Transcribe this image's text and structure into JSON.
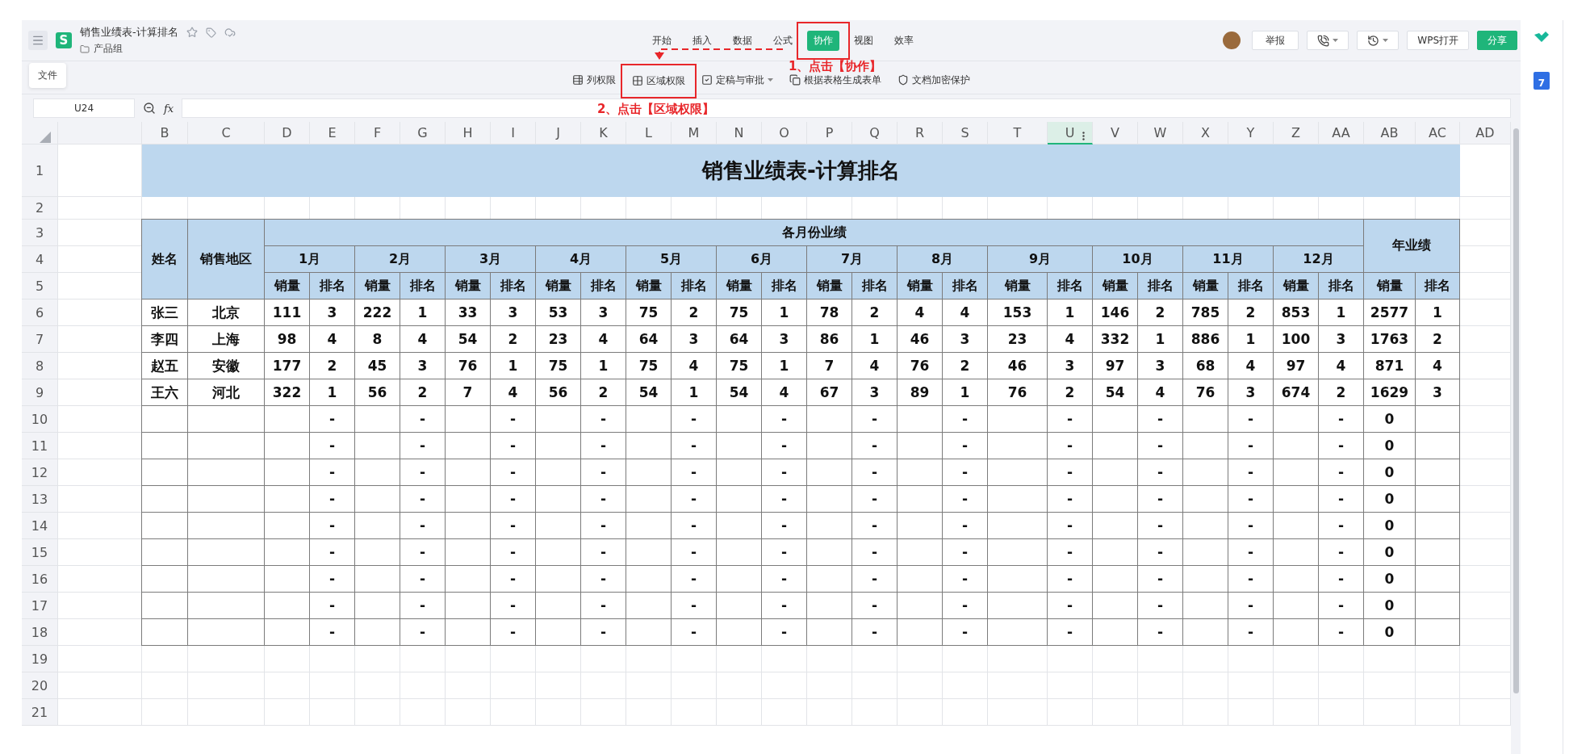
{
  "header": {
    "logo": "S",
    "title": "销售业绩表-计算排名",
    "folder": "产品组"
  },
  "tooltip": "文件",
  "menu_tabs": [
    {
      "label": "开始",
      "selected": false,
      "highlighted": false
    },
    {
      "label": "插入",
      "selected": false,
      "highlighted": false
    },
    {
      "label": "数据",
      "selected": false,
      "highlighted": false
    },
    {
      "label": "公式",
      "selected": false,
      "highlighted": false
    },
    {
      "label": "协作",
      "selected": true,
      "highlighted": true
    },
    {
      "label": "视图",
      "selected": false,
      "highlighted": false
    },
    {
      "label": "效率",
      "selected": false,
      "highlighted": false
    }
  ],
  "ribbon": [
    {
      "label": "列权限",
      "kind": "column-lock",
      "highlighted": false,
      "dropdown": false
    },
    {
      "label": "区域权限",
      "kind": "range-lock",
      "highlighted": true,
      "dropdown": false
    },
    {
      "label": "定稿与审批",
      "kind": "approval",
      "highlighted": false,
      "dropdown": true
    },
    {
      "label": "根据表格生成表单",
      "kind": "form",
      "highlighted": false,
      "dropdown": false
    },
    {
      "label": "文档加密保护",
      "kind": "shield",
      "highlighted": false,
      "dropdown": false
    }
  ],
  "header_buttons": [
    {
      "label": "举报",
      "kind": "text"
    },
    {
      "kind": "phone"
    },
    {
      "kind": "history"
    },
    {
      "label": "WPS打开",
      "kind": "text"
    },
    {
      "label": "分享",
      "kind": "primary"
    }
  ],
  "annotations": [
    {
      "text": "1、点击【协作】"
    },
    {
      "text": "2、点击【区域权限】"
    }
  ],
  "formula_bar": {
    "name_box": "U24",
    "fx_label": "fx"
  },
  "sidebar": {
    "calendar_day": "7"
  },
  "columns": [
    {
      "label": "B",
      "selected": false
    },
    {
      "label": "C",
      "selected": false
    },
    {
      "label": "D",
      "selected": false
    },
    {
      "label": "E",
      "selected": false
    },
    {
      "label": "F",
      "selected": false
    },
    {
      "label": "G",
      "selected": false
    },
    {
      "label": "H",
      "selected": false
    },
    {
      "label": "I",
      "selected": false
    },
    {
      "label": "J",
      "selected": false
    },
    {
      "label": "K",
      "selected": false
    },
    {
      "label": "L",
      "selected": false
    },
    {
      "label": "M",
      "selected": false
    },
    {
      "label": "N",
      "selected": false
    },
    {
      "label": "O",
      "selected": false
    },
    {
      "label": "P",
      "selected": false
    },
    {
      "label": "Q",
      "selected": false
    },
    {
      "label": "R",
      "selected": false
    },
    {
      "label": "S",
      "selected": false
    },
    {
      "label": "T",
      "selected": false
    },
    {
      "label": "U",
      "selected": true
    },
    {
      "label": "V",
      "selected": false
    },
    {
      "label": "W",
      "selected": false
    },
    {
      "label": "X",
      "selected": false
    },
    {
      "label": "Y",
      "selected": false
    },
    {
      "label": "Z",
      "selected": false
    },
    {
      "label": "AA",
      "selected": false
    },
    {
      "label": "AB",
      "selected": false
    },
    {
      "label": "AC",
      "selected": false
    },
    {
      "label": "AD",
      "selected": false
    }
  ],
  "row_numbers": [
    "1",
    "2",
    "3",
    "4",
    "5",
    "6",
    "7",
    "8",
    "9",
    "10",
    "11",
    "12",
    "13",
    "14",
    "15",
    "16",
    "17",
    "18",
    "19",
    "20",
    "21"
  ],
  "sheet": {
    "title": "销售业绩表-计算排名",
    "name_header": "姓名",
    "region_header": "销售地区",
    "group_header": "各月份业绩",
    "months": [
      {
        "label": "1月",
        "sub": [
          "销量",
          "排名"
        ]
      },
      {
        "label": "2月",
        "sub": [
          "销量",
          "排名"
        ]
      },
      {
        "label": "3月",
        "sub": [
          "销量",
          "排名"
        ]
      },
      {
        "label": "4月",
        "sub": [
          "销量",
          "排名"
        ]
      },
      {
        "label": "5月",
        "sub": [
          "销量",
          "排名"
        ]
      },
      {
        "label": "6月",
        "sub": [
          "销量",
          "排名"
        ]
      },
      {
        "label": "7月",
        "sub": [
          "销量",
          "排名"
        ]
      },
      {
        "label": "8月",
        "sub": [
          "销量",
          "排名"
        ]
      },
      {
        "label": "9月",
        "sub": [
          "销量",
          "排名"
        ]
      },
      {
        "label": "10月",
        "sub": [
          "销量",
          "排名"
        ]
      },
      {
        "label": "11月",
        "sub": [
          "销量",
          "排名"
        ]
      },
      {
        "label": "12月",
        "sub": [
          "销量",
          "排名"
        ]
      }
    ],
    "annual": {
      "label": "年业绩",
      "sub": [
        "销量",
        "排名"
      ]
    },
    "records": [
      {
        "name": "张三",
        "region": "北京",
        "months": [
          {
            "sales": "111",
            "rank": "3"
          },
          {
            "sales": "222",
            "rank": "1"
          },
          {
            "sales": "33",
            "rank": "3"
          },
          {
            "sales": "53",
            "rank": "3"
          },
          {
            "sales": "75",
            "rank": "2"
          },
          {
            "sales": "75",
            "rank": "1"
          },
          {
            "sales": "78",
            "rank": "2"
          },
          {
            "sales": "4",
            "rank": "4"
          },
          {
            "sales": "153",
            "rank": "1"
          },
          {
            "sales": "146",
            "rank": "2"
          },
          {
            "sales": "785",
            "rank": "2"
          },
          {
            "sales": "853",
            "rank": "1"
          }
        ],
        "total": {
          "sales": "2577",
          "rank": "1"
        }
      },
      {
        "name": "李四",
        "region": "上海",
        "months": [
          {
            "sales": "98",
            "rank": "4"
          },
          {
            "sales": "8",
            "rank": "4"
          },
          {
            "sales": "54",
            "rank": "2"
          },
          {
            "sales": "23",
            "rank": "4"
          },
          {
            "sales": "64",
            "rank": "3"
          },
          {
            "sales": "64",
            "rank": "3"
          },
          {
            "sales": "86",
            "rank": "1"
          },
          {
            "sales": "46",
            "rank": "3"
          },
          {
            "sales": "23",
            "rank": "4"
          },
          {
            "sales": "332",
            "rank": "1"
          },
          {
            "sales": "886",
            "rank": "1"
          },
          {
            "sales": "100",
            "rank": "3"
          }
        ],
        "total": {
          "sales": "1763",
          "rank": "2"
        }
      },
      {
        "name": "赵五",
        "region": "安徽",
        "months": [
          {
            "sales": "177",
            "rank": "2"
          },
          {
            "sales": "45",
            "rank": "3"
          },
          {
            "sales": "76",
            "rank": "1"
          },
          {
            "sales": "75",
            "rank": "1"
          },
          {
            "sales": "75",
            "rank": "4"
          },
          {
            "sales": "75",
            "rank": "1"
          },
          {
            "sales": "7",
            "rank": "4"
          },
          {
            "sales": "76",
            "rank": "2"
          },
          {
            "sales": "46",
            "rank": "3"
          },
          {
            "sales": "97",
            "rank": "3"
          },
          {
            "sales": "68",
            "rank": "4"
          },
          {
            "sales": "97",
            "rank": "4"
          }
        ],
        "total": {
          "sales": "871",
          "rank": "4"
        }
      },
      {
        "name": "王六",
        "region": "河北",
        "months": [
          {
            "sales": "322",
            "rank": "1"
          },
          {
            "sales": "56",
            "rank": "2"
          },
          {
            "sales": "7",
            "rank": "4"
          },
          {
            "sales": "56",
            "rank": "2"
          },
          {
            "sales": "54",
            "rank": "1"
          },
          {
            "sales": "54",
            "rank": "4"
          },
          {
            "sales": "67",
            "rank": "3"
          },
          {
            "sales": "89",
            "rank": "1"
          },
          {
            "sales": "76",
            "rank": "2"
          },
          {
            "sales": "54",
            "rank": "4"
          },
          {
            "sales": "76",
            "rank": "3"
          },
          {
            "sales": "674",
            "rank": "2"
          }
        ],
        "total": {
          "sales": "1629",
          "rank": "3"
        }
      },
      {
        "months": [
          {
            "rank": "-"
          },
          {
            "rank": "-"
          },
          {
            "rank": "-"
          },
          {
            "rank": "-"
          },
          {
            "rank": "-"
          },
          {
            "rank": "-"
          },
          {
            "rank": "-"
          },
          {
            "rank": "-"
          },
          {
            "rank": "-"
          },
          {
            "rank": "-"
          },
          {
            "rank": "-"
          },
          {
            "rank": "-"
          }
        ],
        "total": {
          "sales": "0"
        }
      },
      {
        "months": [
          {
            "rank": "-"
          },
          {
            "rank": "-"
          },
          {
            "rank": "-"
          },
          {
            "rank": "-"
          },
          {
            "rank": "-"
          },
          {
            "rank": "-"
          },
          {
            "rank": "-"
          },
          {
            "rank": "-"
          },
          {
            "rank": "-"
          },
          {
            "rank": "-"
          },
          {
            "rank": "-"
          },
          {
            "rank": "-"
          }
        ],
        "total": {
          "sales": "0"
        }
      },
      {
        "months": [
          {
            "rank": "-"
          },
          {
            "rank": "-"
          },
          {
            "rank": "-"
          },
          {
            "rank": "-"
          },
          {
            "rank": "-"
          },
          {
            "rank": "-"
          },
          {
            "rank": "-"
          },
          {
            "rank": "-"
          },
          {
            "rank": "-"
          },
          {
            "rank": "-"
          },
          {
            "rank": "-"
          },
          {
            "rank": "-"
          }
        ],
        "total": {
          "sales": "0"
        }
      },
      {
        "months": [
          {
            "rank": "-"
          },
          {
            "rank": "-"
          },
          {
            "rank": "-"
          },
          {
            "rank": "-"
          },
          {
            "rank": "-"
          },
          {
            "rank": "-"
          },
          {
            "rank": "-"
          },
          {
            "rank": "-"
          },
          {
            "rank": "-"
          },
          {
            "rank": "-"
          },
          {
            "rank": "-"
          },
          {
            "rank": "-"
          }
        ],
        "total": {
          "sales": "0"
        }
      },
      {
        "months": [
          {
            "rank": "-"
          },
          {
            "rank": "-"
          },
          {
            "rank": "-"
          },
          {
            "rank": "-"
          },
          {
            "rank": "-"
          },
          {
            "rank": "-"
          },
          {
            "rank": "-"
          },
          {
            "rank": "-"
          },
          {
            "rank": "-"
          },
          {
            "rank": "-"
          },
          {
            "rank": "-"
          },
          {
            "rank": "-"
          }
        ],
        "total": {
          "sales": "0"
        }
      },
      {
        "months": [
          {
            "rank": "-"
          },
          {
            "rank": "-"
          },
          {
            "rank": "-"
          },
          {
            "rank": "-"
          },
          {
            "rank": "-"
          },
          {
            "rank": "-"
          },
          {
            "rank": "-"
          },
          {
            "rank": "-"
          },
          {
            "rank": "-"
          },
          {
            "rank": "-"
          },
          {
            "rank": "-"
          },
          {
            "rank": "-"
          }
        ],
        "total": {
          "sales": "0"
        }
      },
      {
        "months": [
          {
            "rank": "-"
          },
          {
            "rank": "-"
          },
          {
            "rank": "-"
          },
          {
            "rank": "-"
          },
          {
            "rank": "-"
          },
          {
            "rank": "-"
          },
          {
            "rank": "-"
          },
          {
            "rank": "-"
          },
          {
            "rank": "-"
          },
          {
            "rank": "-"
          },
          {
            "rank": "-"
          },
          {
            "rank": "-"
          }
        ],
        "total": {
          "sales": "0"
        }
      },
      {
        "months": [
          {
            "rank": "-"
          },
          {
            "rank": "-"
          },
          {
            "rank": "-"
          },
          {
            "rank": "-"
          },
          {
            "rank": "-"
          },
          {
            "rank": "-"
          },
          {
            "rank": "-"
          },
          {
            "rank": "-"
          },
          {
            "rank": "-"
          },
          {
            "rank": "-"
          },
          {
            "rank": "-"
          },
          {
            "rank": "-"
          }
        ],
        "total": {
          "sales": "0"
        }
      },
      {
        "months": [
          {
            "rank": "-"
          },
          {
            "rank": "-"
          },
          {
            "rank": "-"
          },
          {
            "rank": "-"
          },
          {
            "rank": "-"
          },
          {
            "rank": "-"
          },
          {
            "rank": "-"
          },
          {
            "rank": "-"
          },
          {
            "rank": "-"
          },
          {
            "rank": "-"
          },
          {
            "rank": "-"
          },
          {
            "rank": "-"
          }
        ],
        "total": {
          "sales": "0"
        }
      }
    ]
  }
}
